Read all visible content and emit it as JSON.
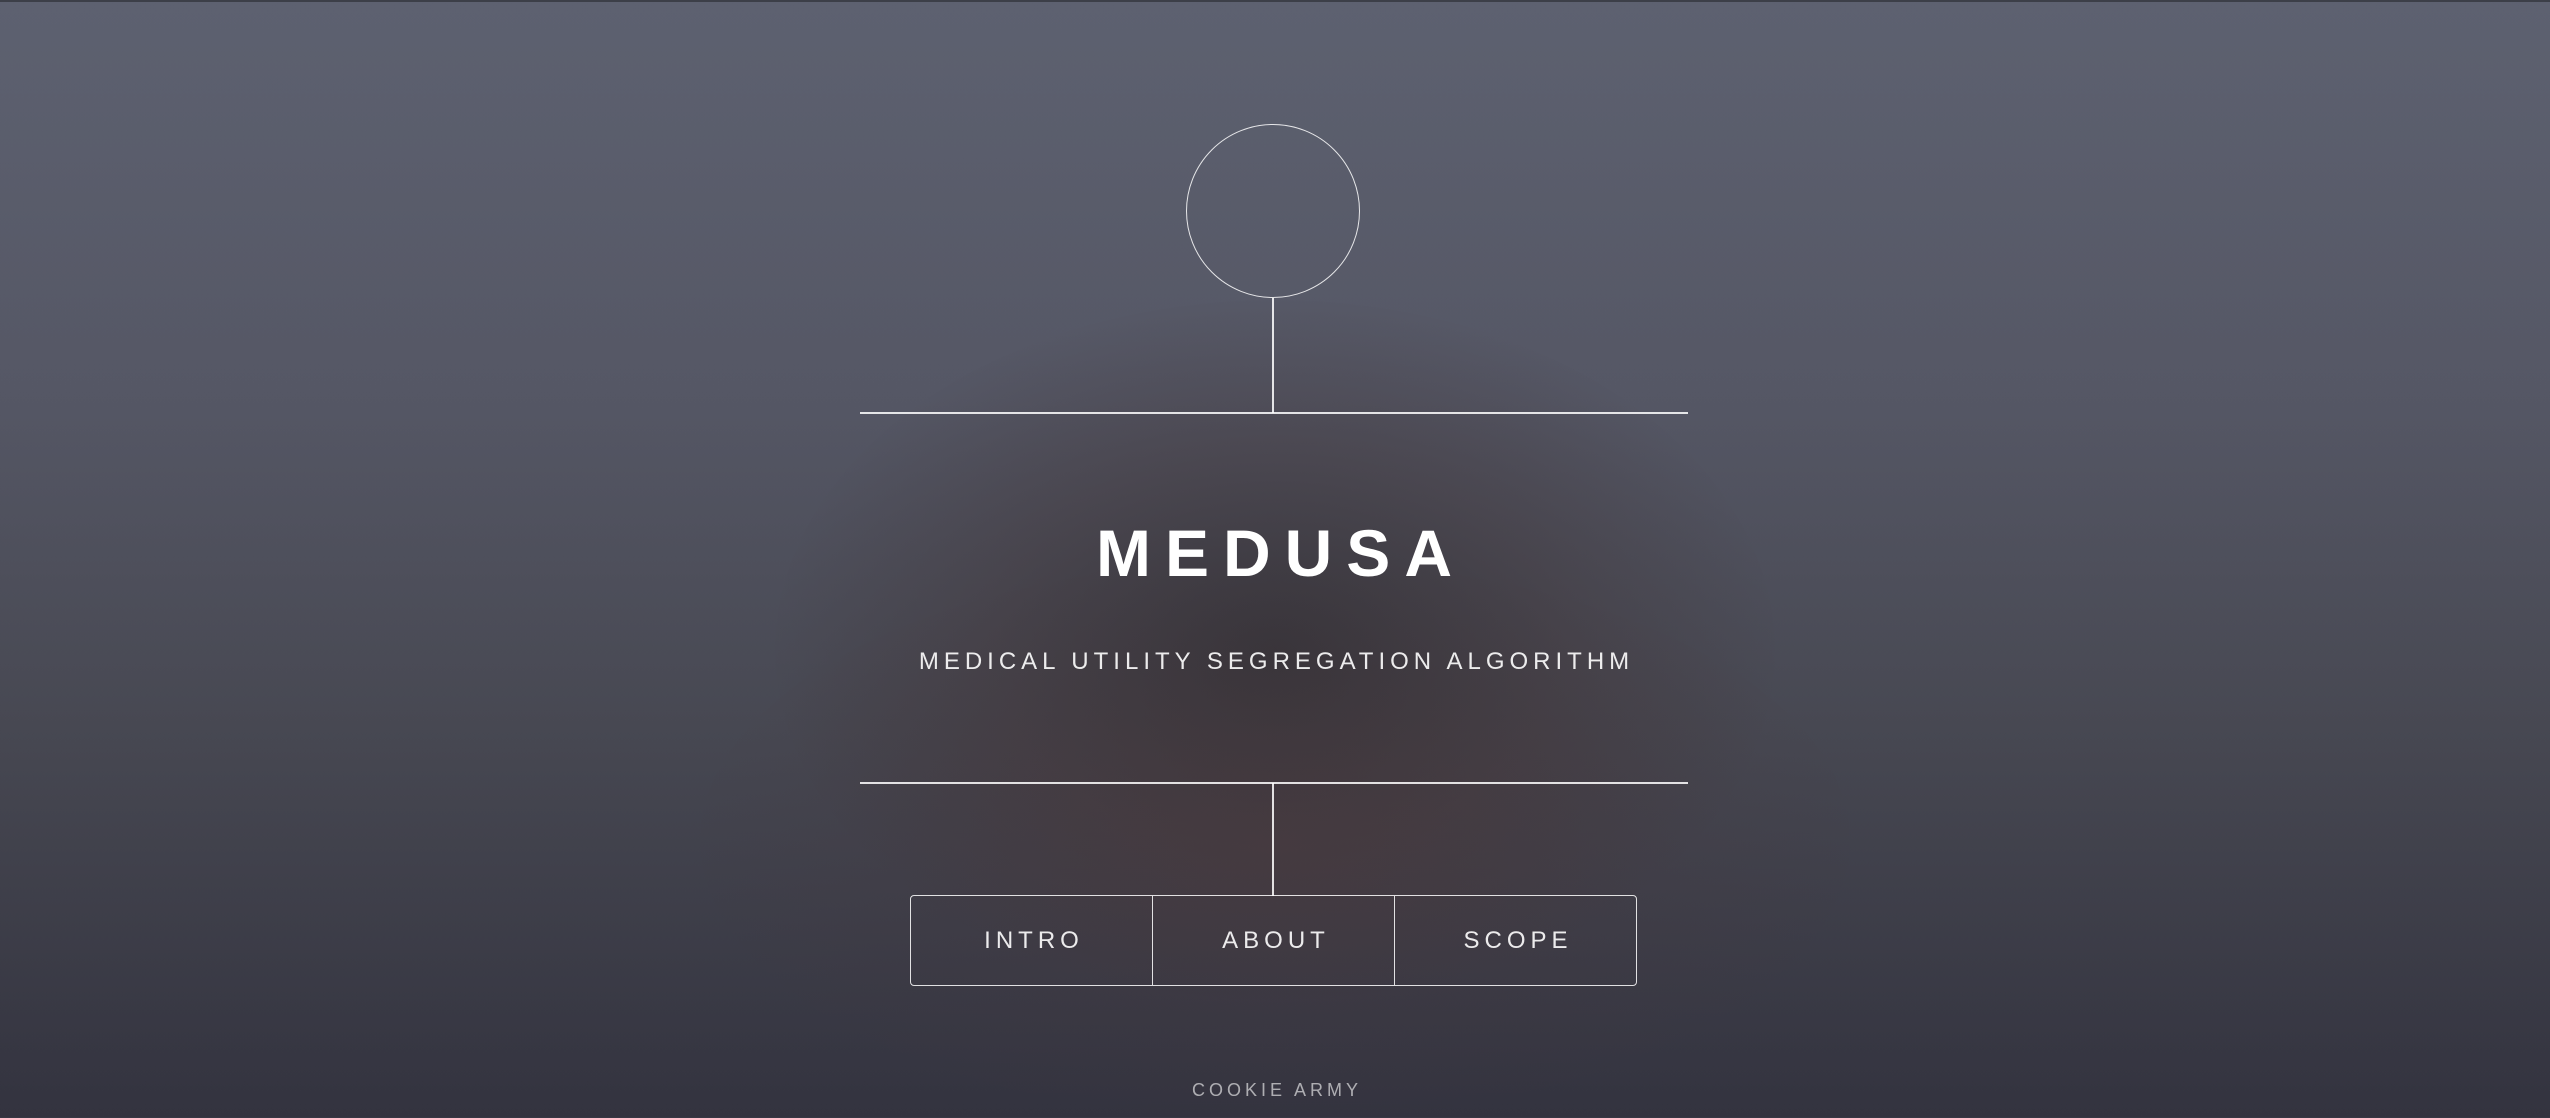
{
  "header": {
    "title": "MEDUSA",
    "subtitle": "MEDICAL UTILITY SEGREGATION ALGORITHM"
  },
  "nav": {
    "items": [
      {
        "label": "INTRO"
      },
      {
        "label": "ABOUT"
      },
      {
        "label": "SCOPE"
      }
    ]
  },
  "footer": {
    "text": "COOKIE ARMY"
  },
  "colors": {
    "background_top": "#5d6170",
    "background_bottom": "#33333f",
    "line": "#ffffff",
    "text": "#ffffff"
  }
}
